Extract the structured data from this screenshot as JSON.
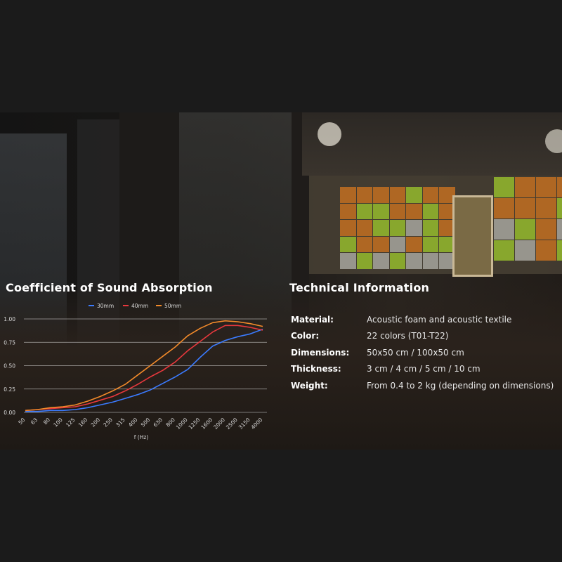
{
  "left_heading": "Coefficient of Sound Absorption",
  "right_heading": "Technical Information",
  "colors": {
    "series_30": "#3b7bff",
    "series_40": "#e8383d",
    "series_50": "#f28a2a",
    "panel_orange": "#d9781f",
    "panel_green": "#a4d12c",
    "panel_grey": "#b9b9b1",
    "grid": "#dcdcdc",
    "text": "#ffffff"
  },
  "chart_data": {
    "type": "line",
    "title": "",
    "xlabel": "f (Hz)",
    "ylabel": "",
    "categories": [
      "50",
      "63",
      "80",
      "100",
      "125",
      "160",
      "200",
      "250",
      "315",
      "400",
      "500",
      "630",
      "800",
      "1000",
      "1250",
      "1600",
      "2000",
      "2500",
      "3150",
      "4000"
    ],
    "ylim": [
      0,
      1
    ],
    "y_ticks": [
      "0.00",
      "0.25",
      "0.50",
      "0.75",
      "1.00"
    ],
    "grid": true,
    "legend_position": "top",
    "series": [
      {
        "name": "30mm",
        "values": [
          0.01,
          0.01,
          0.02,
          0.02,
          0.03,
          0.05,
          0.08,
          0.11,
          0.15,
          0.19,
          0.24,
          0.31,
          0.38,
          0.46,
          0.59,
          0.71,
          0.77,
          0.81,
          0.84,
          0.89
        ]
      },
      {
        "name": "40mm",
        "values": [
          0.02,
          0.03,
          0.04,
          0.05,
          0.06,
          0.09,
          0.13,
          0.17,
          0.23,
          0.3,
          0.38,
          0.45,
          0.54,
          0.66,
          0.76,
          0.86,
          0.93,
          0.93,
          0.91,
          0.88
        ]
      },
      {
        "name": "50mm",
        "values": [
          0.02,
          0.03,
          0.05,
          0.06,
          0.08,
          0.12,
          0.17,
          0.23,
          0.3,
          0.4,
          0.5,
          0.6,
          0.7,
          0.82,
          0.9,
          0.96,
          0.98,
          0.97,
          0.95,
          0.92
        ]
      }
    ]
  },
  "tech_info": [
    {
      "label": "Material:",
      "value": "Acoustic foam and acoustic textile"
    },
    {
      "label": "Color:",
      "value": "22 colors (T01-T22)"
    },
    {
      "label": "Dimensions:",
      "value": "50x50 cm / 100x50 cm"
    },
    {
      "label": "Thickness:",
      "value": "3 cm / 4 cm / 5 cm / 10 cm"
    },
    {
      "label": "Weight:",
      "value": "From 0.4 to 2 kg (depending on dimensions)"
    }
  ]
}
